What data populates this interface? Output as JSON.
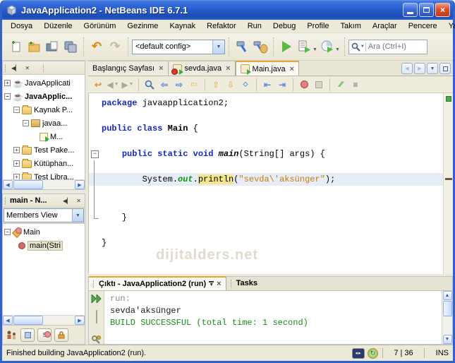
{
  "window": {
    "title": "JavaApplication2 - NetBeans IDE 6.7.1"
  },
  "menu": {
    "items": [
      "Dosya",
      "Düzenle",
      "Görünüm",
      "Gezinme",
      "Kaynak",
      "Refaktor",
      "Run",
      "Debug",
      "Profile",
      "Takım",
      "Araçlar",
      "Pencere",
      "Yardım"
    ]
  },
  "toolbar": {
    "config_value": "<default config>",
    "search_placeholder": "Ara (Ctrl+I)"
  },
  "icons": {
    "window": "netbeans-cube",
    "new_file": "page-plus",
    "new_project": "folder-plus",
    "open_project": "folder-open",
    "save_all": "disks",
    "undo": "curved-arrow-left",
    "redo": "curved-arrow-right",
    "build": "hammer",
    "clean_build": "hammer-broom",
    "run": "green-play",
    "debug": "debug-play",
    "profile": "profiler-clock",
    "search": "magnifier",
    "rerun": "double-green-play",
    "stop": "gray-square",
    "ant_settings": "gear",
    "project_node": "coffee-cup",
    "source_folder": "folder",
    "package": "package-box",
    "class_file": "class-page-green-play",
    "method": "red-circle"
  },
  "projects": {
    "app1": "JavaApplicati",
    "app2": "JavaApplic...",
    "src": "Kaynak P...",
    "pkg": "javaa...",
    "cls": "M...",
    "test": "Test Pake...",
    "lib": "Kütüphan...",
    "testlib": "Test Libra..."
  },
  "navigator": {
    "title": "main - N...",
    "view": "Members View",
    "class_label": "Main",
    "method_label": "main(Stri"
  },
  "editor": {
    "tabs": [
      {
        "label": "Başlangıç Sayfası",
        "icon": "none",
        "active": false
      },
      {
        "label": "sevda.java",
        "icon": "java-error",
        "active": false
      },
      {
        "label": "Main.java",
        "icon": "java",
        "active": true
      }
    ],
    "watermark": "dijitalders.net",
    "code": {
      "lines": [
        {
          "gutter": "",
          "segs": [
            {
              "c": "kw",
              "t": "package"
            },
            {
              "c": "pl",
              "t": " javaapplication2;"
            }
          ]
        },
        {
          "gutter": "",
          "segs": []
        },
        {
          "gutter": "",
          "segs": [
            {
              "c": "kw",
              "t": "public class "
            },
            {
              "c": "cls",
              "t": "Main"
            },
            {
              "c": "pl",
              "t": " {"
            }
          ]
        },
        {
          "gutter": "",
          "segs": []
        },
        {
          "gutter": "fold",
          "segs": [
            {
              "c": "pl",
              "t": "    "
            },
            {
              "c": "kw",
              "t": "public static void "
            },
            {
              "c": "mth",
              "t": "main"
            },
            {
              "c": "pl",
              "t": "(String[] args) {"
            }
          ]
        },
        {
          "gutter": "line",
          "segs": []
        },
        {
          "gutter": "line",
          "current": true,
          "segs": [
            {
              "c": "pl",
              "t": "        System."
            },
            {
              "c": "fld",
              "t": "out"
            },
            {
              "c": "pl",
              "t": "."
            },
            {
              "c": "hl",
              "t": "println"
            },
            {
              "c": "pl",
              "t": "("
            },
            {
              "c": "str",
              "t": "\"sevda\\'aksünger\""
            },
            {
              "c": "pl",
              "t": ");"
            }
          ]
        },
        {
          "gutter": "line",
          "segs": []
        },
        {
          "gutter": "line",
          "segs": []
        },
        {
          "gutter": "corner",
          "segs": [
            {
              "c": "pl",
              "t": "    }"
            }
          ]
        },
        {
          "gutter": "",
          "segs": []
        },
        {
          "gutter": "",
          "segs": [
            {
              "c": "pl",
              "t": "}"
            }
          ]
        }
      ]
    }
  },
  "output": {
    "title": "Çıktı - JavaApplication2 (run)",
    "tasks": "Tasks",
    "lines": [
      {
        "cls": "out-gray",
        "text": "run:"
      },
      {
        "cls": "out-black",
        "text": "sevda'aksünger"
      },
      {
        "cls": "out-green",
        "text": "BUILD SUCCESSFUL (total time: 1 second)"
      }
    ]
  },
  "statusbar": {
    "message": "Finished building JavaApplication2 (run).",
    "caret": "7 | 36",
    "mode": "INS"
  }
}
